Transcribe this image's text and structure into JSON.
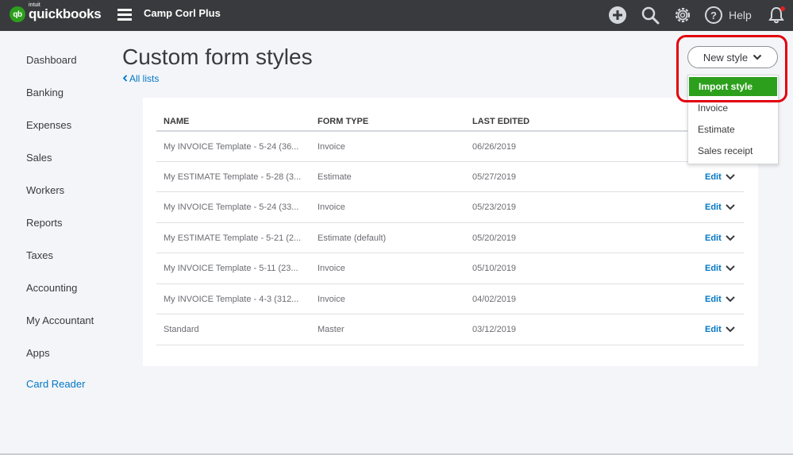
{
  "brand": {
    "intuit": "intuit",
    "name": "quickbooks",
    "badge": "qb"
  },
  "company": "Camp Corl Plus",
  "topbar": {
    "help": "Help"
  },
  "sidebar": {
    "items": [
      {
        "label": "Dashboard"
      },
      {
        "label": "Banking"
      },
      {
        "label": "Expenses"
      },
      {
        "label": "Sales"
      },
      {
        "label": "Workers"
      },
      {
        "label": "Reports"
      },
      {
        "label": "Taxes"
      },
      {
        "label": "Accounting"
      },
      {
        "label": "My Accountant"
      },
      {
        "label": "Apps"
      },
      {
        "label": "Card Reader"
      }
    ]
  },
  "page": {
    "title": "Custom form styles",
    "back_link": "All lists"
  },
  "new_style": {
    "label": "New style",
    "options": [
      "Import style",
      "Invoice",
      "Estimate",
      "Sales receipt"
    ]
  },
  "table": {
    "headers": {
      "name": "NAME",
      "form_type": "FORM TYPE",
      "last_edited": "LAST EDITED"
    },
    "edit_label": "Edit",
    "rows": [
      {
        "name": "My INVOICE Template - 5-24 (36...",
        "form_type": "Invoice",
        "last_edited": "06/26/2019"
      },
      {
        "name": "My ESTIMATE Template - 5-28 (3...",
        "form_type": "Estimate",
        "last_edited": "05/27/2019"
      },
      {
        "name": "My INVOICE Template - 5-24 (33...",
        "form_type": "Invoice",
        "last_edited": "05/23/2019"
      },
      {
        "name": "My ESTIMATE Template - 5-21 (2...",
        "form_type": "Estimate (default)",
        "last_edited": "05/20/2019"
      },
      {
        "name": "My INVOICE Template - 5-11 (23...",
        "form_type": "Invoice",
        "last_edited": "05/10/2019"
      },
      {
        "name": "My INVOICE Template - 4-3 (312...",
        "form_type": "Invoice",
        "last_edited": "04/02/2019"
      },
      {
        "name": "Standard",
        "form_type": "Master",
        "last_edited": "03/12/2019"
      }
    ]
  },
  "colors": {
    "accent": "#2ca01c",
    "link": "#0077c5",
    "topbar": "#393a3d",
    "highlight": "#e3000f"
  }
}
